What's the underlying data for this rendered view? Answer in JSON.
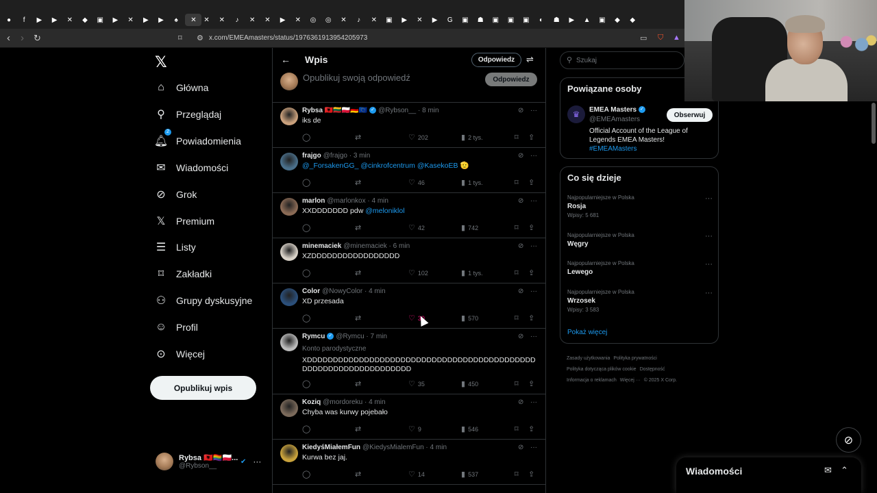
{
  "browser": {
    "url": "x.com/EMEAmasters/status/1976361913954205973",
    "tabs": [
      "●",
      "f",
      "▶",
      "▶",
      "✕",
      "◆",
      "▣",
      "▶",
      "✕",
      "▶",
      "▶",
      "♠",
      "✕",
      "✕",
      "✕",
      "♪",
      "✕",
      "✕",
      "▶",
      "✕",
      "◎",
      "◎",
      "✕",
      "♪",
      "✕",
      "▣",
      "▶",
      "✕",
      "▶",
      "G",
      "▣",
      "☗",
      "▣",
      "▣",
      "▣",
      "◐",
      "☗",
      "▶",
      "▲",
      "▣",
      "◆",
      "◆"
    ]
  },
  "nav": {
    "items": [
      {
        "label": "Główna",
        "icon": "home-icon",
        "glyph": "⌂"
      },
      {
        "label": "Przeglądaj",
        "icon": "search-icon",
        "glyph": "⚲"
      },
      {
        "label": "Powiadomienia",
        "icon": "bell-icon",
        "glyph": "🔔︎",
        "badge": "2"
      },
      {
        "label": "Wiadomości",
        "icon": "mail-icon",
        "glyph": "✉"
      },
      {
        "label": "Grok",
        "icon": "grok-icon",
        "glyph": "⊘"
      },
      {
        "label": "Premium",
        "icon": "x-icon",
        "glyph": "𝕏"
      },
      {
        "label": "Listy",
        "icon": "list-icon",
        "glyph": "☰"
      },
      {
        "label": "Zakładki",
        "icon": "bookmark-icon",
        "glyph": "⌑"
      },
      {
        "label": "Grupy dyskusyjne",
        "icon": "communities-icon",
        "glyph": "⚇"
      },
      {
        "label": "Profil",
        "icon": "profile-icon",
        "glyph": "☺"
      },
      {
        "label": "Więcej",
        "icon": "more-circle-icon",
        "glyph": "⊙"
      }
    ],
    "post_button": "Opublikuj wpis",
    "me": {
      "name": "Rybsa 🇦🇱🏳️‍🌈🇵🇱...",
      "handle": "@Rybson__"
    }
  },
  "main": {
    "title": "Wpis",
    "reply_pill": "Odpowiedz",
    "composer_placeholder": "Opublikuj swoją odpowiedź",
    "composer_button": "Odpowiedz"
  },
  "tweets": [
    {
      "name": "Rybsa 🇦🇱🇱🇹🇵🇱🇩🇪🇪🇺",
      "handle": "@Rybson__",
      "time": "8 min",
      "verified": true,
      "text": "iks de",
      "replies": "",
      "retweets": "",
      "likes": "202",
      "views": "2 tys."
    },
    {
      "name": "frajgo",
      "handle": "@frajgo",
      "time": "3 min",
      "verified": false,
      "text": "@_ForsakenGG_ @cinkrofcentrum @KasekoEB 🫡",
      "replies": "",
      "retweets": "",
      "likes": "46",
      "views": "1 tys."
    },
    {
      "name": "marlon",
      "handle": "@marlonkox",
      "time": "4 min",
      "verified": false,
      "text": "XXDDDDDDD pdw @meloniklol",
      "replies": "",
      "retweets": "",
      "likes": "42",
      "views": "742"
    },
    {
      "name": "minemaciek",
      "handle": "@minemaciek",
      "time": "6 min",
      "verified": false,
      "text": "XZDDDDDDDDDDDDDDDDD",
      "replies": "",
      "retweets": "",
      "likes": "102",
      "views": "1 tys."
    },
    {
      "name": "Color",
      "handle": "@NowyColor",
      "time": "4 min",
      "verified": false,
      "text": "XD przesada",
      "replies": "",
      "retweets": "",
      "likes": "30",
      "views": "570",
      "liked_hover": true
    },
    {
      "name": "Rymcu",
      "handle": "@Rymcu",
      "time": "7 min",
      "verified": true,
      "parody": "Konto parodystyczne",
      "text": "XDDDDDDDDDDDDDDDDDDDDDDDDDDDDDDDDDDDDDDDDDDDDDDDDDDDDDDDDDDDDDDDDD",
      "replies": "",
      "retweets": "",
      "likes": "35",
      "views": "450"
    },
    {
      "name": "Koziq",
      "handle": "@mordoreku",
      "time": "4 min",
      "verified": false,
      "text": "Chyba was kurwy pojebało",
      "replies": "",
      "retweets": "",
      "likes": "9",
      "views": "546"
    },
    {
      "name": "KiedyśMiałemFun",
      "handle": "@KiedysMialemFun",
      "time": "4 min",
      "verified": false,
      "text": "Kurwa bez jaj.",
      "replies": "",
      "retweets": "",
      "likes": "14",
      "views": "537"
    }
  ],
  "right": {
    "search_placeholder": "Szukaj",
    "related": {
      "title": "Powiązane osoby",
      "name": "EMEA Masters",
      "handle": "@EMEAmasters",
      "follow": "Obserwuj",
      "bio": "Official Account of the League of Legends EMEA Masters!",
      "bio_tag": "#EMEAMasters"
    },
    "trends": {
      "title": "Co się dzieje",
      "items": [
        {
          "category": "Najpopularniejsze w Polska",
          "name": "Rosja",
          "count": "Wpisy: 5 681"
        },
        {
          "category": "Najpopularniejsze w Polska",
          "name": "Węgry",
          "count": ""
        },
        {
          "category": "Najpopularniejsze w Polska",
          "name": "Lewego",
          "count": ""
        },
        {
          "category": "Najpopularniejsze w Polska",
          "name": "Wrzosek",
          "count": "Wpisy: 3 583"
        }
      ],
      "show_more": "Pokaż więcej"
    },
    "footer": [
      "Zasady użytkowania",
      "Polityka prywatności",
      "Polityka dotycząca plików cookie",
      "Dostępność",
      "Informacja o reklamach",
      "Więcej ···",
      "© 2025 X Corp."
    ]
  },
  "dm": {
    "title": "Wiadomości"
  }
}
